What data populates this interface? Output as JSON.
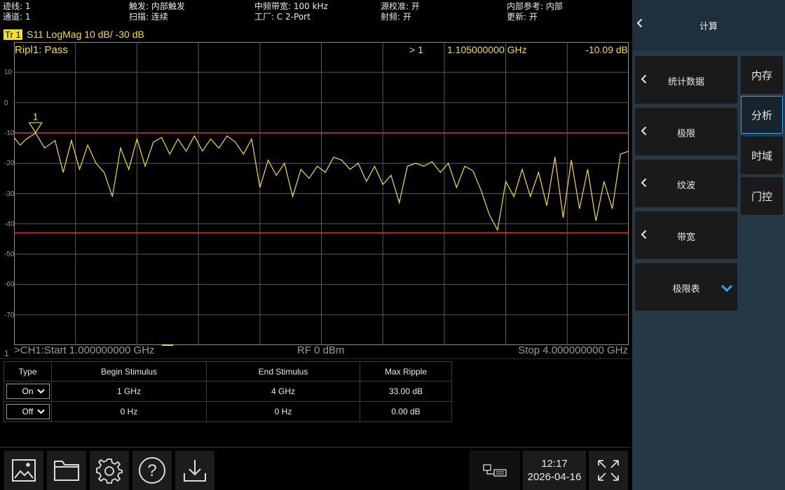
{
  "status": {
    "trace_count": "迹线: 1",
    "channel_count": "通道: 1",
    "trigger": "触发: 内部触发",
    "sweep": "扫描: 连续",
    "if_bandwidth": "中频带宽: 100 kHz",
    "cal_kit": "工厂: C 2-Port",
    "source_cal": "源校准: 开",
    "rf": "射频: 开",
    "ref": "内部参考: 内部",
    "update": "更新: 开"
  },
  "trace": {
    "badge": "Tr 1",
    "description": "S11  LogMag  10 dB/  -30 dB",
    "color": "#f5e02a"
  },
  "ripple_status": "Ripl1: Pass",
  "marker": {
    "active_indicator": "> 1",
    "frequency": "1.105000000 GHz",
    "value": "-10.09 dB",
    "label": "1"
  },
  "channel": {
    "start": ">CH1:Start 1.000000000 GHz",
    "power": "RF 0 dBm",
    "stop": "Stop 4.000000000 GHz",
    "number": "1"
  },
  "chart_data": {
    "type": "line",
    "ylabel": "",
    "xlabel": "",
    "xlim": [
      1.0,
      4.0
    ],
    "ylim": [
      -80,
      20
    ],
    "yticks": [
      10,
      0,
      -10,
      -20,
      -30,
      -40,
      -50,
      -60,
      -70
    ],
    "grid": true,
    "limit_lines": [
      -10.0,
      -43.0
    ],
    "limit_color": "#e0303c",
    "series": [
      {
        "color": "#f5e02a",
        "x": [
          1.0,
          1.03,
          1.06,
          1.105,
          1.15,
          1.2,
          1.24,
          1.28,
          1.32,
          1.36,
          1.4,
          1.44,
          1.48,
          1.52,
          1.56,
          1.6,
          1.64,
          1.68,
          1.72,
          1.76,
          1.8,
          1.84,
          1.88,
          1.92,
          1.96,
          2.0,
          2.04,
          2.08,
          2.12,
          2.16,
          2.2,
          2.24,
          2.28,
          2.32,
          2.36,
          2.4,
          2.44,
          2.48,
          2.52,
          2.56,
          2.6,
          2.64,
          2.68,
          2.72,
          2.76,
          2.8,
          2.84,
          2.88,
          2.92,
          2.96,
          3.0,
          3.04,
          3.08,
          3.12,
          3.16,
          3.2,
          3.24,
          3.28,
          3.32,
          3.36,
          3.4,
          3.44,
          3.48,
          3.52,
          3.56,
          3.6,
          3.64,
          3.68,
          3.72,
          3.76,
          3.8,
          3.84,
          3.88,
          3.92,
          3.96,
          4.0
        ],
        "y": [
          -11.5,
          -14.0,
          -12.0,
          -10.1,
          -15.0,
          -12.5,
          -23.0,
          -12.5,
          -22.0,
          -14.0,
          -20.0,
          -23.0,
          -31.0,
          -15.0,
          -22.0,
          -12.0,
          -21.0,
          -13.0,
          -11.5,
          -17.0,
          -12.0,
          -16.0,
          -11.0,
          -16.0,
          -12.0,
          -15.0,
          -11.0,
          -13.0,
          -17.0,
          -12.0,
          -28.0,
          -19.0,
          -24.0,
          -20.0,
          -31.0,
          -22.0,
          -25.0,
          -21.0,
          -23.0,
          -18.0,
          -19.0,
          -22.0,
          -20.0,
          -26.0,
          -21.0,
          -27.0,
          -24.0,
          -33.0,
          -21.0,
          -20.0,
          -21.0,
          -19.5,
          -23.0,
          -20.0,
          -28.0,
          -21.0,
          -22.5,
          -29.0,
          -37.0,
          -42.0,
          -26.0,
          -31.0,
          -22.0,
          -31.0,
          -23.0,
          -34.0,
          -18.0,
          -38.0,
          -19.0,
          -35.0,
          -22.0,
          -39.0,
          -26.0,
          -35.0,
          -17.0,
          -16.0
        ]
      }
    ]
  },
  "limit_table": {
    "headers": [
      "Type",
      "Begin Stimulus",
      "End Stimulus",
      "Max Ripple"
    ],
    "rows": [
      {
        "type": "On",
        "begin": "1 GHz",
        "end": "4 GHz",
        "ripple": "33.00 dB"
      },
      {
        "type": "Off",
        "begin": "0 Hz",
        "end": "0 Hz",
        "ripple": "0.00 dB"
      }
    ]
  },
  "toolbar": {
    "icons": [
      "image-icon",
      "folder-icon",
      "gear-icon",
      "help-icon",
      "download-icon"
    ]
  },
  "clock": {
    "time": "12:17",
    "date": "2026-04-16"
  },
  "menu": {
    "title": "计算",
    "items": [
      "统计数据",
      "极限",
      "纹波",
      "带宽",
      "极限表"
    ],
    "tabs": [
      "内存",
      "分析",
      "时域",
      "门控"
    ],
    "active_tab": "分析",
    "accent": "#3aa0e8"
  }
}
